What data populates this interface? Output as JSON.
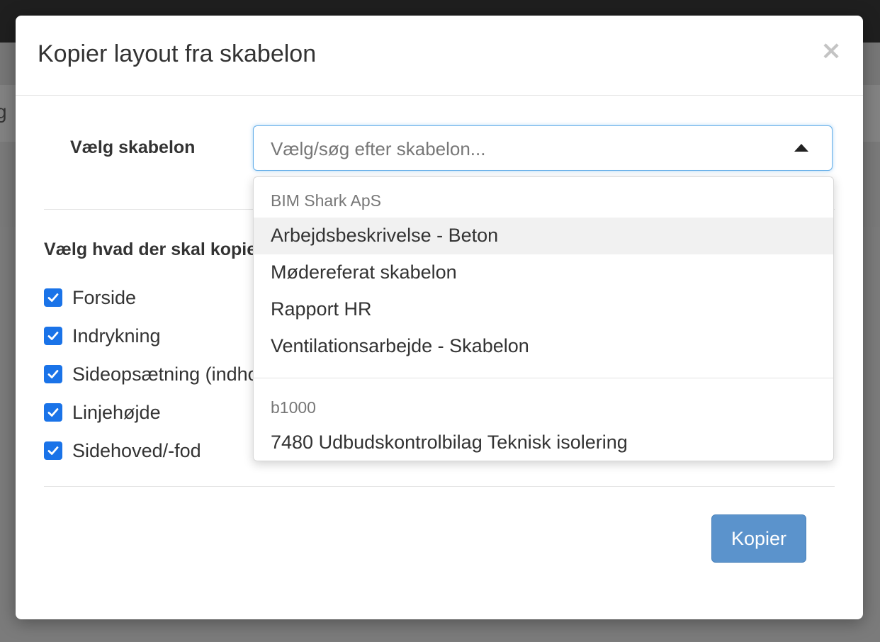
{
  "background": {
    "partial_text": "g"
  },
  "modal": {
    "title": "Kopier layout fra skabelon",
    "close_symbol": "×"
  },
  "template_select": {
    "label": "Vælg skabelon",
    "placeholder": "Vælg/søg efter skabelon...",
    "state": "open"
  },
  "copy_options": {
    "title": "Vælg hvad der skal kopieres",
    "items": [
      {
        "label": "Forside",
        "checked": true
      },
      {
        "label": "Indrykning",
        "checked": true
      },
      {
        "label": "Sideopsætning (indhold)",
        "checked": true
      },
      {
        "label": "Linjehøjde",
        "checked": true
      },
      {
        "label": "Sidehoved/-fod",
        "checked": true
      }
    ]
  },
  "dropdown": {
    "groups": [
      {
        "name": "BIM Shark ApS",
        "options": [
          "Arbejdsbeskrivelse - Beton",
          "Mødereferat skabelon",
          "Rapport HR",
          "Ventilationsarbejde - Skabelon"
        ]
      },
      {
        "name": "b1000",
        "options": [
          "7480 Udbudskontrolbilag Teknisk isolering"
        ]
      }
    ],
    "highlighted": "Arbejdsbeskrivelse - Beton"
  },
  "actions": {
    "copy_label": "Kopier"
  },
  "colors": {
    "checkbox": "#1a73e8",
    "primary_button": "#5b93cc",
    "focus_border": "#66afe9"
  }
}
